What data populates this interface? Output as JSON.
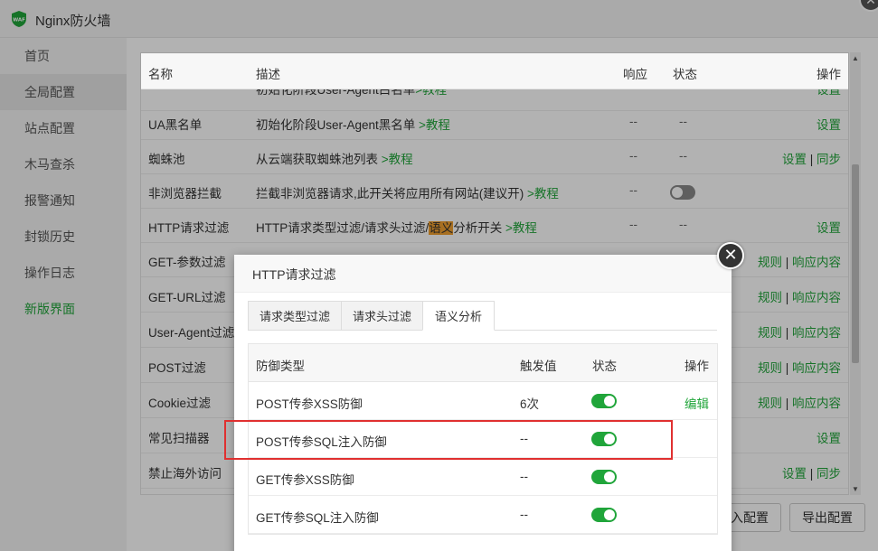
{
  "app": {
    "title": "Nginx防火墙",
    "logo_text": "WAF"
  },
  "sidebar": {
    "items": [
      {
        "label": "首页"
      },
      {
        "label": "全局配置"
      },
      {
        "label": "站点配置"
      },
      {
        "label": "木马查杀"
      },
      {
        "label": "报警通知"
      },
      {
        "label": "封锁历史"
      },
      {
        "label": "操作日志"
      },
      {
        "label": "新版界面"
      }
    ]
  },
  "table": {
    "headers": {
      "name": "名称",
      "desc": "描述",
      "resp": "响应",
      "state": "状态",
      "op": "操作"
    },
    "partial_row": {
      "desc": "初始化阶段User-Agent白名单",
      "link": ">教程",
      "op": "设置"
    },
    "rows": [
      {
        "name": "UA黑名单",
        "desc": "初始化阶段User-Agent黑名单",
        "link": ">教程",
        "resp": "--",
        "state": "--",
        "op1": "设置"
      },
      {
        "name": "蜘蛛池",
        "desc": "从云端获取蜘蛛池列表",
        "link": ">教程",
        "resp": "--",
        "state": "--",
        "op1": "设置",
        "sep": "|",
        "op2": "同步"
      },
      {
        "name": "非浏览器拦截",
        "desc": "拦截非浏览器请求,此开关将应用所有网站(建议开)",
        "link": ">教程",
        "resp": "--"
      },
      {
        "name": "HTTP请求过滤",
        "desc_a": "HTTP请求类型过滤/请求头过滤/",
        "desc_hl": "语义",
        "desc_b": "分析开关",
        "link": ">教程",
        "resp": "--",
        "state": "--",
        "op1": "设置"
      },
      {
        "name": "GET-参数过滤",
        "op1": "规则",
        "sep": "|",
        "op2": "响应内容"
      },
      {
        "name": "GET-URL过滤",
        "op1": "规则",
        "sep": "|",
        "op2": "响应内容"
      },
      {
        "name": "User-Agent过滤",
        "op1": "规则",
        "sep": "|",
        "op2": "响应内容"
      },
      {
        "name": "POST过滤",
        "op1": "规则",
        "sep": "|",
        "op2": "响应内容"
      },
      {
        "name": "Cookie过滤",
        "op1": "规则",
        "sep": "|",
        "op2": "响应内容"
      },
      {
        "name": "常见扫描器",
        "op1": "设置"
      },
      {
        "name": "禁止海外访问",
        "op1": "设置",
        "sep": "|",
        "op2": "同步"
      }
    ]
  },
  "buttons": {
    "import_label": "导入配置",
    "export_label": "导出配置"
  },
  "modal": {
    "title": "HTTP请求过滤",
    "tabs": [
      {
        "label": "请求类型过滤"
      },
      {
        "label": "请求头过滤"
      },
      {
        "label": "语义分析"
      }
    ],
    "table": {
      "headers": {
        "type": "防御类型",
        "value": "触发值",
        "state": "状态",
        "op": "操作"
      },
      "rows": [
        {
          "type": "POST传参XSS防御",
          "value": "6次",
          "enabled": true,
          "op": "编辑"
        },
        {
          "type": "POST传参SQL注入防御",
          "value": "--",
          "enabled": true,
          "op": ""
        },
        {
          "type": "GET传参XSS防御",
          "value": "--",
          "enabled": true,
          "op": ""
        },
        {
          "type": "GET传参SQL注入防御",
          "value": "--",
          "enabled": true,
          "op": ""
        }
      ]
    }
  },
  "colors": {
    "accent": "#20a53a",
    "highlight": "#f0a030",
    "annotation": "#e03030"
  }
}
